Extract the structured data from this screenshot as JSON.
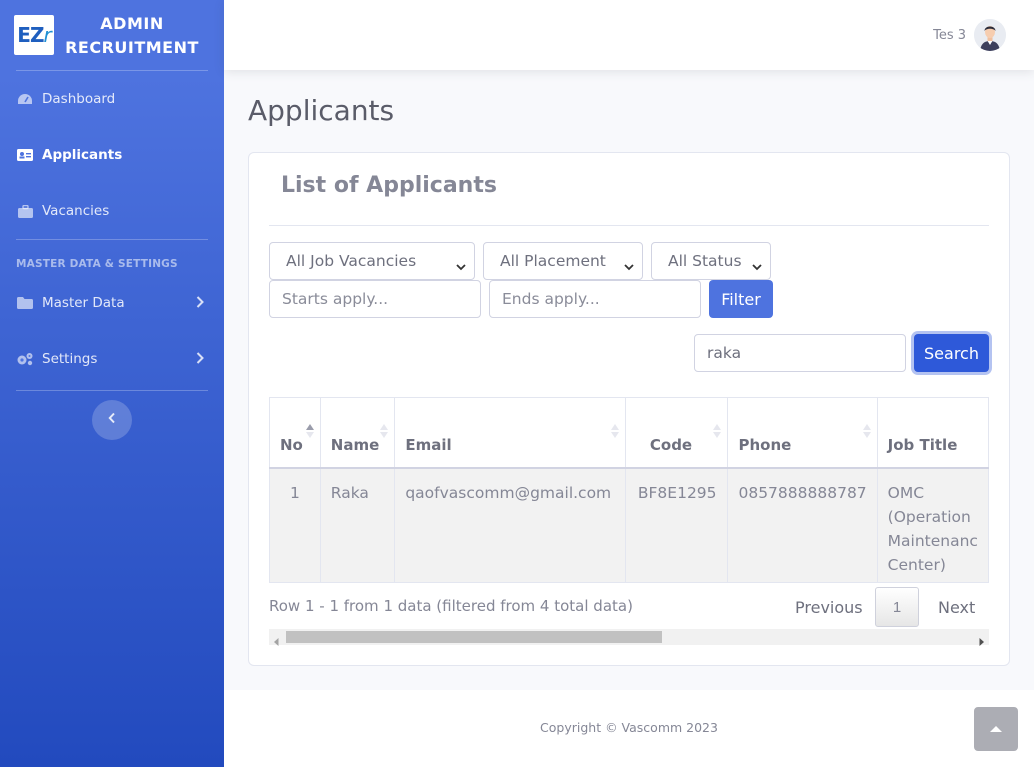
{
  "brand": {
    "logo_text": "EZ",
    "logo_italic": "r",
    "line1": "ADMIN",
    "line2": "RECRUITMENT"
  },
  "sidebar": {
    "items": [
      {
        "label": "Dashboard",
        "icon": "tachometer-icon"
      },
      {
        "label": "Applicants",
        "icon": "id-card-icon"
      },
      {
        "label": "Vacancies",
        "icon": "briefcase-icon"
      }
    ],
    "heading": "MASTER DATA & SETTINGS",
    "items2": [
      {
        "label": "Master Data",
        "icon": "folder-icon"
      },
      {
        "label": "Settings",
        "icon": "cogs-icon"
      }
    ]
  },
  "topbar": {
    "user_name": "Tes 3"
  },
  "page": {
    "title": "Applicants"
  },
  "card": {
    "title": "List of Applicants",
    "filters": {
      "job_vacancies": "All Job Vacancies",
      "placement": "All Placement",
      "status": "All Status",
      "starts_placeholder": "Starts apply...",
      "ends_placeholder": "Ends apply...",
      "filter_label": "Filter"
    },
    "search": {
      "value": "raka",
      "button": "Search"
    },
    "table": {
      "headers": [
        "No",
        "Name",
        "Email",
        "Code",
        "Phone",
        "Job Title"
      ],
      "rows": [
        {
          "no": "1",
          "name": "Raka",
          "email": "qaofvascomm@gmail.com",
          "code": "BF8E1295",
          "phone": "0857888888787",
          "job_line1": "OMC",
          "job_line2": "(Operation",
          "job_line3": "Maintenanc",
          "job_line4": "Center)"
        }
      ]
    },
    "info": "Row 1 - 1 from 1 data (filtered from 4 total data)",
    "pagination": {
      "previous": "Previous",
      "current": "1",
      "next": "Next"
    }
  },
  "footer": {
    "copyright": "Copyright © Vascomm 2023"
  },
  "colors": {
    "primary": "#4e73df",
    "sidebar_end": "#224abe"
  }
}
